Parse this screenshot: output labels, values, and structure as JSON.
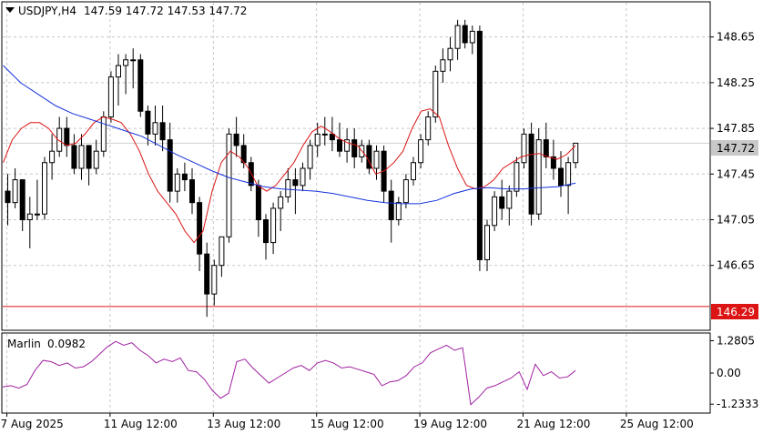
{
  "header": {
    "symbol": "USDJPY,H4",
    "ohlc": "147.59 147.72 147.53 147.72"
  },
  "osc_header": {
    "name": "Marlin",
    "value": "0.0982"
  },
  "price_badge": "147.72",
  "level_badge": "146.29",
  "colors": {
    "bull_body": "#ffffff",
    "bear_body": "#000000",
    "ma_fast": "#dc1414",
    "ma_slow": "#1432dc",
    "level_line": "#dc1414",
    "oscillator": "#a020a0",
    "grid": "#c8c8c8"
  },
  "icons": {
    "menu": "triangle-down-icon"
  },
  "chart_data": [
    {
      "type": "candlestick",
      "title": "USDJPY,H4",
      "price_ticks": [
        "148.65",
        "148.25",
        "147.85",
        "147.45",
        "147.05",
        "146.65"
      ],
      "price_tick_values": [
        148.65,
        148.25,
        147.85,
        147.45,
        147.05,
        146.65
      ],
      "ylim": [
        146.09,
        148.95
      ],
      "time_labels": [
        "7 Aug 2025",
        "11 Aug 12:00",
        "13 Aug 12:00",
        "15 Aug 12:00",
        "19 Aug 12:00",
        "21 Aug 12:00",
        "25 Aug 12:00"
      ],
      "time_label_bars": [
        0,
        14,
        28,
        42,
        56,
        70,
        84
      ],
      "horizontal_level": 146.29,
      "last_price": 147.72,
      "candles": [
        [
          147.3,
          147.45,
          147.0,
          147.2
        ],
        [
          147.2,
          147.5,
          147.15,
          147.4
        ],
        [
          147.4,
          147.4,
          146.95,
          147.05
        ],
        [
          147.05,
          147.25,
          146.8,
          147.1
        ],
        [
          147.1,
          147.4,
          147.05,
          147.1
        ],
        [
          147.1,
          147.6,
          147.05,
          147.55
        ],
        [
          147.55,
          147.8,
          147.4,
          147.65
        ],
        [
          147.65,
          147.95,
          147.6,
          147.85
        ],
        [
          147.85,
          147.95,
          147.6,
          147.7
        ],
        [
          147.7,
          147.8,
          147.45,
          147.5
        ],
        [
          147.5,
          147.8,
          147.4,
          147.7
        ],
        [
          147.7,
          147.7,
          147.35,
          147.5
        ],
        [
          147.5,
          147.75,
          147.45,
          147.65
        ],
        [
          147.65,
          148.0,
          147.6,
          147.95
        ],
        [
          147.95,
          148.35,
          147.9,
          148.3
        ],
        [
          148.3,
          148.5,
          148.05,
          148.4
        ],
        [
          148.4,
          148.5,
          148.15,
          148.45
        ],
        [
          148.45,
          148.55,
          148.2,
          148.45
        ],
        [
          148.45,
          148.5,
          147.95,
          148.0
        ],
        [
          148.0,
          148.05,
          147.7,
          147.8
        ],
        [
          147.8,
          148.05,
          147.7,
          147.9
        ],
        [
          147.9,
          148.05,
          147.65,
          147.75
        ],
        [
          147.75,
          147.9,
          147.2,
          147.3
        ],
        [
          147.3,
          147.5,
          147.2,
          147.45
        ],
        [
          147.45,
          147.55,
          147.3,
          147.4
        ],
        [
          147.4,
          147.5,
          147.1,
          147.2
        ],
        [
          147.2,
          147.25,
          146.6,
          146.75
        ],
        [
          146.75,
          146.85,
          146.2,
          146.4
        ],
        [
          146.4,
          146.7,
          146.3,
          146.65
        ],
        [
          146.65,
          146.9,
          146.55,
          146.9
        ],
        [
          146.9,
          147.85,
          146.85,
          147.8
        ],
        [
          147.8,
          147.95,
          147.6,
          147.7
        ],
        [
          147.7,
          147.8,
          147.5,
          147.55
        ],
        [
          147.55,
          147.6,
          147.3,
          147.35
        ],
        [
          147.35,
          147.4,
          146.9,
          147.05
        ],
        [
          147.05,
          147.1,
          146.7,
          146.85
        ],
        [
          146.85,
          147.2,
          146.75,
          147.15
        ],
        [
          147.15,
          147.3,
          146.95,
          147.25
        ],
        [
          147.25,
          147.5,
          147.2,
          147.4
        ],
        [
          147.4,
          147.5,
          147.1,
          147.35
        ],
        [
          147.35,
          147.55,
          147.3,
          147.5
        ],
        [
          147.5,
          147.75,
          147.4,
          147.7
        ],
        [
          147.7,
          147.9,
          147.6,
          147.8
        ],
        [
          147.8,
          147.95,
          147.7,
          147.8
        ],
        [
          147.8,
          147.95,
          147.65,
          147.75
        ],
        [
          147.75,
          147.9,
          147.6,
          147.65
        ],
        [
          147.65,
          147.85,
          147.55,
          147.75
        ],
        [
          147.75,
          147.85,
          147.5,
          147.6
        ],
        [
          147.6,
          147.75,
          147.55,
          147.7
        ],
        [
          147.7,
          147.75,
          147.45,
          147.5
        ],
        [
          147.5,
          147.7,
          147.4,
          147.65
        ],
        [
          147.65,
          147.7,
          147.2,
          147.3
        ],
        [
          147.3,
          147.4,
          146.85,
          147.05
        ],
        [
          147.05,
          147.25,
          147.0,
          147.2
        ],
        [
          147.2,
          147.45,
          147.15,
          147.4
        ],
        [
          147.4,
          147.6,
          147.35,
          147.55
        ],
        [
          147.55,
          147.8,
          147.5,
          147.75
        ],
        [
          147.75,
          148.0,
          147.7,
          147.95
        ],
        [
          147.95,
          148.4,
          147.9,
          148.35
        ],
        [
          148.35,
          148.55,
          148.25,
          148.45
        ],
        [
          148.45,
          148.65,
          148.35,
          148.55
        ],
        [
          148.55,
          148.8,
          148.45,
          148.75
        ],
        [
          148.75,
          148.8,
          148.55,
          148.6
        ],
        [
          148.6,
          148.75,
          148.5,
          148.7
        ],
        [
          148.7,
          148.75,
          146.6,
          146.7
        ],
        [
          146.7,
          147.05,
          146.6,
          147.0
        ],
        [
          147.0,
          147.3,
          146.95,
          147.25
        ],
        [
          147.25,
          147.4,
          147.05,
          147.15
        ],
        [
          147.15,
          147.35,
          147.0,
          147.3
        ],
        [
          147.3,
          147.6,
          147.25,
          147.55
        ],
        [
          147.55,
          147.85,
          147.5,
          147.8
        ],
        [
          147.8,
          147.9,
          147.0,
          147.1
        ],
        [
          147.1,
          147.85,
          147.05,
          147.75
        ],
        [
          147.75,
          147.9,
          147.5,
          147.6
        ],
        [
          147.6,
          147.75,
          147.4,
          147.5
        ],
        [
          147.5,
          147.65,
          147.25,
          147.35
        ],
        [
          147.35,
          147.6,
          147.1,
          147.55
        ],
        [
          147.55,
          147.72,
          147.5,
          147.72
        ]
      ],
      "series": [
        {
          "values": [
            147.55,
            147.75,
            147.85,
            147.9,
            147.9,
            147.85,
            147.75,
            147.7,
            147.72,
            147.8,
            147.9,
            147.95,
            147.93,
            147.9,
            147.8,
            147.65,
            147.45,
            147.3,
            147.2,
            147.1,
            146.95,
            146.85,
            146.95,
            147.3,
            147.55,
            147.65,
            147.6,
            147.5,
            147.35,
            147.3,
            147.35,
            147.45,
            147.55,
            147.7,
            147.82,
            147.87,
            147.82,
            147.76,
            147.72,
            147.7,
            147.6,
            147.45,
            147.48,
            147.55,
            147.65,
            147.85,
            148.0,
            148.02,
            147.95,
            147.7,
            147.5,
            147.35,
            147.32,
            147.34,
            147.4,
            147.5,
            147.55,
            147.6,
            147.62,
            147.63,
            147.6,
            147.58,
            147.62,
            147.7
          ]
        },
        {
          "values": [
            148.4,
            148.25,
            148.15,
            148.05,
            147.98,
            147.93,
            147.88,
            147.83,
            147.78,
            147.7,
            147.62,
            147.55,
            147.48,
            147.42,
            147.38,
            147.34,
            147.32,
            147.31,
            147.3,
            147.28,
            147.25,
            147.22,
            147.2,
            147.19,
            147.19,
            147.22,
            147.28,
            147.32,
            147.33,
            147.32,
            147.32,
            147.33,
            147.34,
            147.37
          ]
        }
      ]
    },
    {
      "type": "line",
      "title": "Marlin 0.0982",
      "yticks": [
        "1.2805",
        "0.00",
        "-1.2333"
      ],
      "ytick_values": [
        1.2805,
        0.0,
        -1.2333
      ],
      "ylim": [
        -1.55,
        1.55
      ],
      "series": [
        {
          "values": [
            -0.55,
            -0.5,
            -0.6,
            -0.45,
            0.1,
            0.5,
            0.45,
            0.3,
            0.4,
            0.2,
            0.25,
            0.45,
            0.75,
            1.05,
            1.25,
            1.1,
            1.2,
            0.9,
            0.7,
            0.4,
            0.55,
            0.45,
            0.6,
            0.1,
            0.05,
            -0.25,
            -0.7,
            -1.0,
            -0.8,
            0.45,
            0.55,
            0.2,
            -0.1,
            -0.4,
            -0.2,
            0.0,
            0.2,
            0.3,
            0.1,
            0.4,
            0.5,
            0.4,
            0.2,
            0.25,
            0.15,
            0.05,
            -0.05,
            -0.5,
            -0.35,
            -0.3,
            -0.1,
            0.25,
            0.4,
            0.8,
            0.95,
            1.1,
            0.9,
            1.0,
            -1.25,
            -0.95,
            -0.6,
            -0.5,
            -0.35,
            -0.2,
            0.05,
            -0.65,
            0.35,
            -0.1,
            0.05,
            -0.2,
            -0.15,
            0.1
          ]
        }
      ]
    }
  ]
}
